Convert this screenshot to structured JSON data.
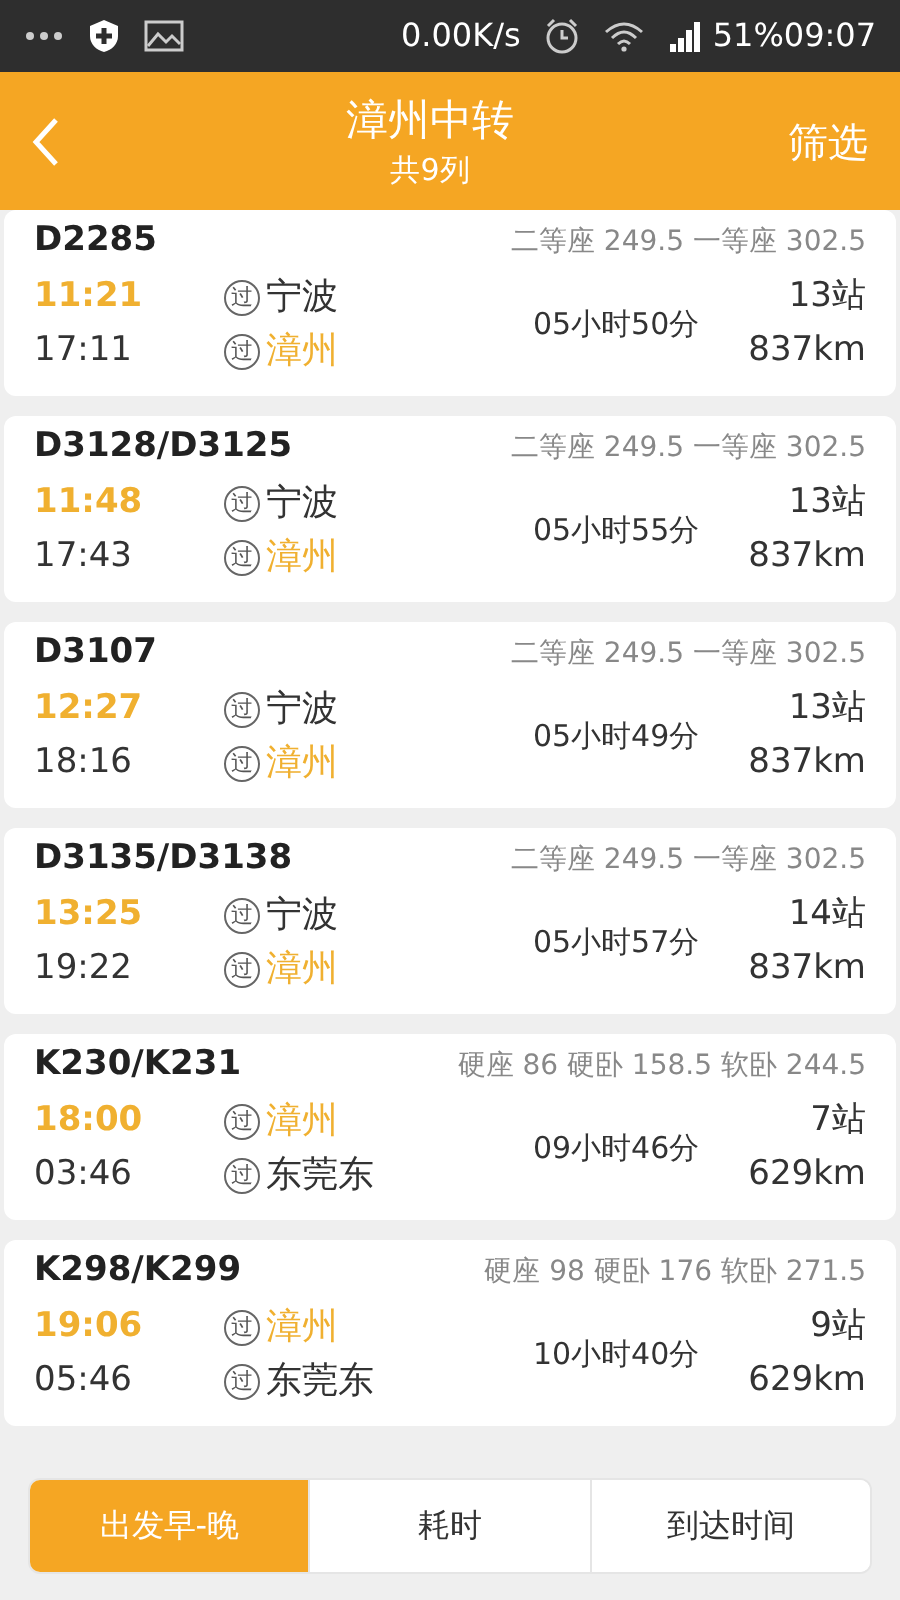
{
  "status_bar": {
    "network_speed": "0.00K/s",
    "battery_time": "51%09:07"
  },
  "header": {
    "title": "漳州中转",
    "subtitle": "共9列",
    "action": "筛选"
  },
  "trains": [
    {
      "code": "D2285",
      "prices": "二等座 249.5 一等座 302.5",
      "depart": "11:21",
      "arrive": "17:11",
      "stations": [
        {
          "mark": "过",
          "name": "宁波",
          "highlight": false
        },
        {
          "mark": "过",
          "name": "漳州",
          "highlight": true
        }
      ],
      "duration": "05小时50分",
      "stops": "13站",
      "distance": "837km"
    },
    {
      "code": "D3128/D3125",
      "prices": "二等座 249.5 一等座 302.5",
      "depart": "11:48",
      "arrive": "17:43",
      "stations": [
        {
          "mark": "过",
          "name": "宁波",
          "highlight": false
        },
        {
          "mark": "过",
          "name": "漳州",
          "highlight": true
        }
      ],
      "duration": "05小时55分",
      "stops": "13站",
      "distance": "837km"
    },
    {
      "code": "D3107",
      "prices": "二等座 249.5 一等座 302.5",
      "depart": "12:27",
      "arrive": "18:16",
      "stations": [
        {
          "mark": "过",
          "name": "宁波",
          "highlight": false
        },
        {
          "mark": "过",
          "name": "漳州",
          "highlight": true
        }
      ],
      "duration": "05小时49分",
      "stops": "13站",
      "distance": "837km"
    },
    {
      "code": "D3135/D3138",
      "prices": "二等座 249.5 一等座 302.5",
      "depart": "13:25",
      "arrive": "19:22",
      "stations": [
        {
          "mark": "过",
          "name": "宁波",
          "highlight": false
        },
        {
          "mark": "过",
          "name": "漳州",
          "highlight": true
        }
      ],
      "duration": "05小时57分",
      "stops": "14站",
      "distance": "837km"
    },
    {
      "code": "K230/K231",
      "prices": "硬座 86 硬卧 158.5 软卧 244.5",
      "depart": "18:00",
      "arrive": "03:46",
      "stations": [
        {
          "mark": "过",
          "name": "漳州",
          "highlight": true
        },
        {
          "mark": "过",
          "name": "东莞东",
          "highlight": false
        }
      ],
      "duration": "09小时46分",
      "stops": "7站",
      "distance": "629km"
    },
    {
      "code": "K298/K299",
      "prices": "硬座 98 硬卧 176 软卧 271.5",
      "depart": "19:06",
      "arrive": "05:46",
      "stations": [
        {
          "mark": "过",
          "name": "漳州",
          "highlight": true
        },
        {
          "mark": "过",
          "name": "东莞东",
          "highlight": false
        }
      ],
      "duration": "10小时40分",
      "stops": "9站",
      "distance": "629km"
    }
  ],
  "sort_tabs": [
    {
      "label": "出发早-晚",
      "selected": true
    },
    {
      "label": "耗时",
      "selected": false
    },
    {
      "label": "到达时间",
      "selected": false
    }
  ]
}
